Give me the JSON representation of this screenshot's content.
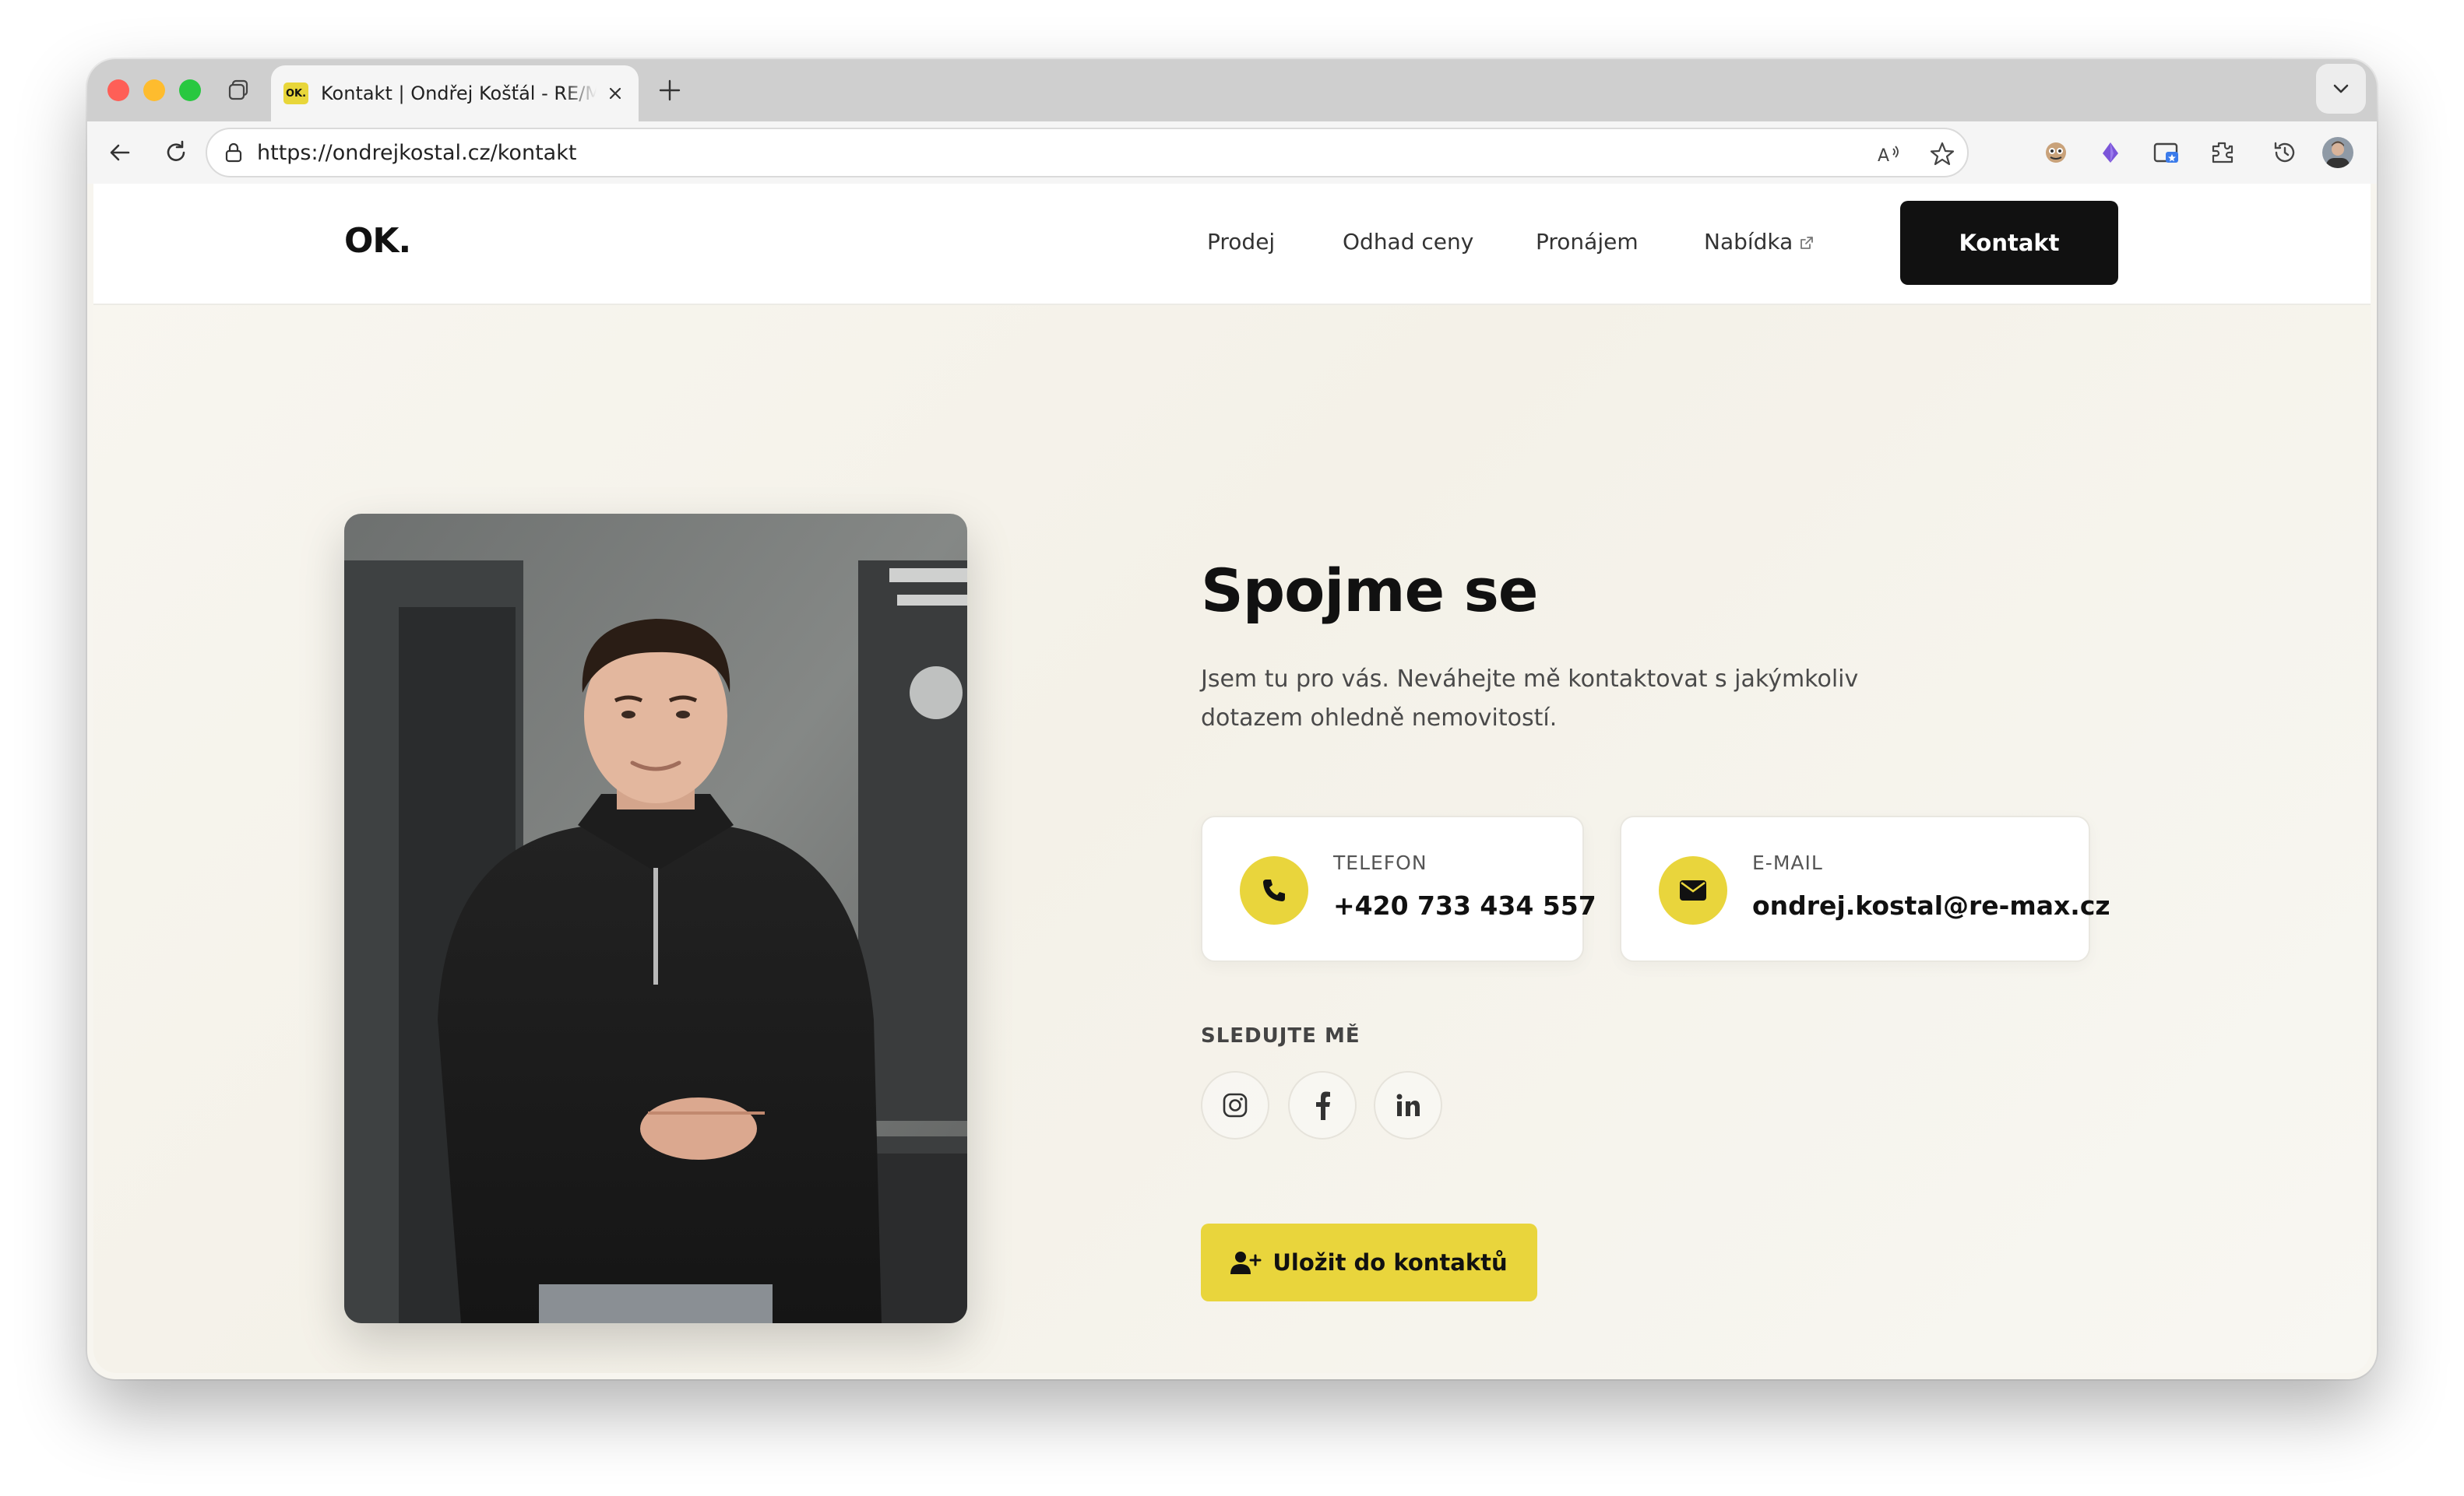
{
  "browser": {
    "tab_title": "Kontakt | Ondřej Košťál - RE/MAX",
    "favicon_text": "OK.",
    "url": "https://ondrejkostal.cz/kontakt",
    "icons": [
      "back-icon",
      "reload-icon",
      "lock-icon",
      "read-aloud-icon",
      "favorite-star-icon",
      "extension-icon",
      "profile-avatar"
    ]
  },
  "site": {
    "logo": "OK.",
    "nav": {
      "prodej": "Prodej",
      "odhad": "Odhad ceny",
      "pronajem": "Pronájem",
      "nabidka": "Nabídka",
      "kontakt": "Kontakt"
    }
  },
  "contact": {
    "heading": "Spojme se",
    "lead": "Jsem tu pro vás. Neváhejte mě kontaktovat s jakýmkoliv dotazem ohledně nemovitostí.",
    "phone_label": "TELEFON",
    "phone_value": "+420 733 434 557",
    "email_label": "E-MAIL",
    "email_value": "ondrej.kostal@re-max.cz",
    "follow_label": "SLEDUJTE MĚ",
    "social": [
      "instagram-icon",
      "facebook-icon",
      "linkedin-icon"
    ],
    "save_label": "Uložit do kontaktů"
  },
  "colors": {
    "accent": "#e9d53c",
    "dark": "#111111",
    "background": "#f7f5ef"
  }
}
